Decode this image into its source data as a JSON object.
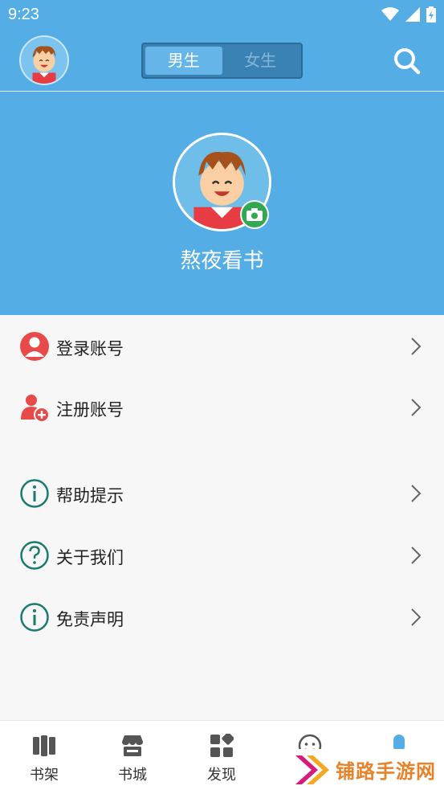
{
  "status_bar": {
    "time": "9:23",
    "icons": [
      "wifi-icon",
      "signal-icon",
      "battery-icon"
    ]
  },
  "header": {
    "gender_tabs": [
      {
        "label": "男生",
        "active": true
      },
      {
        "label": "女生",
        "active": false
      }
    ],
    "search_icon": "search-icon"
  },
  "profile": {
    "name": "熬夜看书",
    "camera_icon": "camera-icon"
  },
  "menu": {
    "items": [
      {
        "label": "登录账号",
        "icon": "user-icon"
      },
      {
        "label": "注册账号",
        "icon": "add-user-icon"
      },
      {
        "label": "帮助提示",
        "icon": "info-icon"
      },
      {
        "label": "关于我们",
        "icon": "question-icon"
      },
      {
        "label": "免责声明",
        "icon": "info-icon"
      }
    ]
  },
  "bottom_nav": {
    "items": [
      {
        "label": "书架",
        "icon": "bookshelf-icon"
      },
      {
        "label": "书城",
        "icon": "bookstore-icon"
      },
      {
        "label": "发现",
        "icon": "discover-icon"
      },
      {
        "label": "",
        "icon": "community-icon"
      },
      {
        "label": "",
        "icon": "profile-icon",
        "active": true
      }
    ]
  },
  "watermark": {
    "text": "铺路手游网"
  },
  "colors": {
    "primary": "#54aee5",
    "accent_green": "#33a852",
    "menu_red": "#e84a4a",
    "menu_teal": "#1a7a6e"
  }
}
